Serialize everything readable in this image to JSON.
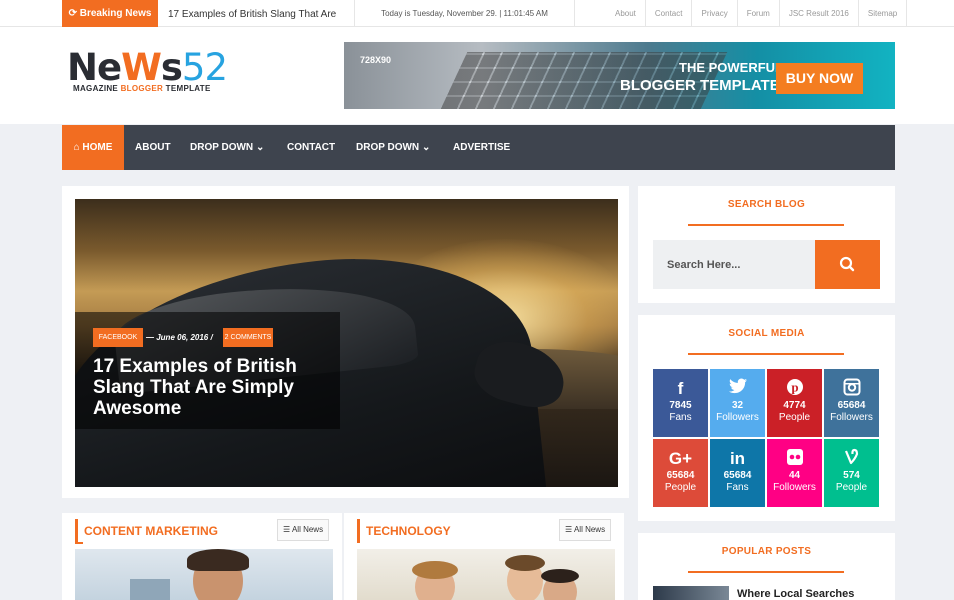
{
  "topbar": {
    "breaking_label": "Breaking News",
    "breaking_headline": "17 Examples of British Slang That Are",
    "date_text": "Today is Tuesday, November 29. | 11:01:45 AM",
    "links": [
      "About",
      "Contact",
      "Privacy",
      "Forum",
      "JSC Result 2016",
      "Sitemap"
    ]
  },
  "logo": {
    "part_ne": "Ne",
    "part_w": "W",
    "part_s": "s",
    "part_num": "52",
    "tagline_a": "MAGAZINE ",
    "tagline_b": "BLOGGER",
    "tagline_c": " TEMPLATE"
  },
  "banner": {
    "size_label": "728X90",
    "line1": "THE POWERFUL",
    "line2": "BLOGGER TEMPLATE",
    "cta": "BUY NOW"
  },
  "nav": {
    "home": "HOME",
    "items": [
      "ABOUT",
      "DROP DOWN",
      "CONTACT",
      "DROP DOWN",
      "ADVERTISE"
    ]
  },
  "featured": {
    "category": "FACEBOOK",
    "date": "— June 06, 2016 /",
    "comments": "2 COMMENTS",
    "title": "17 Examples of British Slang That Are Simply Awesome"
  },
  "categories": [
    {
      "title": "CONTENT MARKETING",
      "all_label": "All News"
    },
    {
      "title": "TECHNOLOGY",
      "all_label": "All News"
    }
  ],
  "sidebar": {
    "search_title": "SEARCH BLOG",
    "search_placeholder": "Search Here...",
    "social_title": "SOCIAL MEDIA",
    "social": [
      {
        "icon": "f",
        "count": "7845",
        "label": "Fans",
        "color": "#3b5998"
      },
      {
        "icon": "twitter",
        "count": "32",
        "label": "Followers",
        "color": "#55acee"
      },
      {
        "icon": "pinterest",
        "count": "4774",
        "label": "People",
        "color": "#cb2027"
      },
      {
        "icon": "instagram",
        "count": "65684",
        "label": "Followers",
        "color": "#3f729b"
      },
      {
        "icon": "G+",
        "count": "65684",
        "label": "People",
        "color": "#dd4b39"
      },
      {
        "icon": "in",
        "count": "65684",
        "label": "Fans",
        "color": "#0e76a8"
      },
      {
        "icon": "flickr",
        "count": "44",
        "label": "Followers",
        "color": "#ff0084"
      },
      {
        "icon": "vine",
        "count": "574",
        "label": "People",
        "color": "#00bf8f"
      }
    ],
    "popular_title": "POPULAR POSTS",
    "popular_first": "Where Local Searches"
  },
  "colors": {
    "accent": "#f26d21",
    "nav_bg": "#3e444e"
  }
}
